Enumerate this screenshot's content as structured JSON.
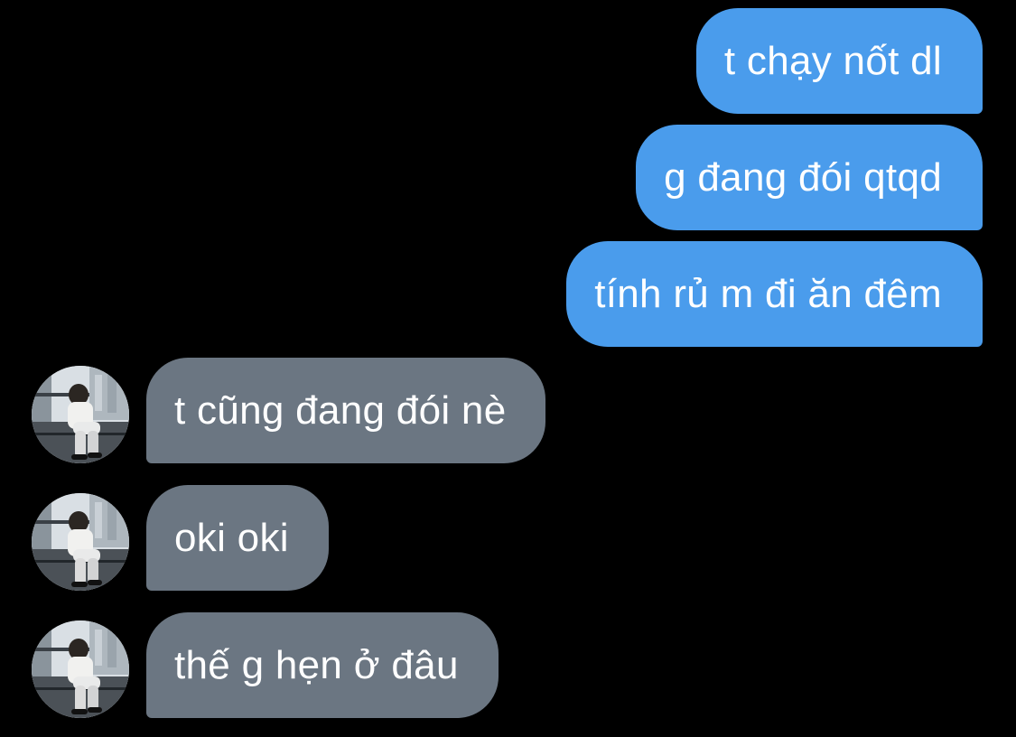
{
  "messages": [
    {
      "direction": "outgoing",
      "text": "t chạy nốt dl"
    },
    {
      "direction": "outgoing",
      "text": "g đang đói qtqd"
    },
    {
      "direction": "outgoing",
      "text": "tính rủ m đi ăn đêm"
    },
    {
      "direction": "incoming",
      "text": "t cũng đang đói nè",
      "avatar": "contact-avatar"
    },
    {
      "direction": "incoming",
      "text": "oki oki",
      "avatar": "contact-avatar"
    },
    {
      "direction": "incoming",
      "text": "thế g hẹn ở đâu",
      "avatar": "contact-avatar"
    }
  ],
  "colors": {
    "background": "#000000",
    "outgoing_bubble": "#4a9cec",
    "incoming_bubble": "#6b7682",
    "text": "#ffffff"
  }
}
